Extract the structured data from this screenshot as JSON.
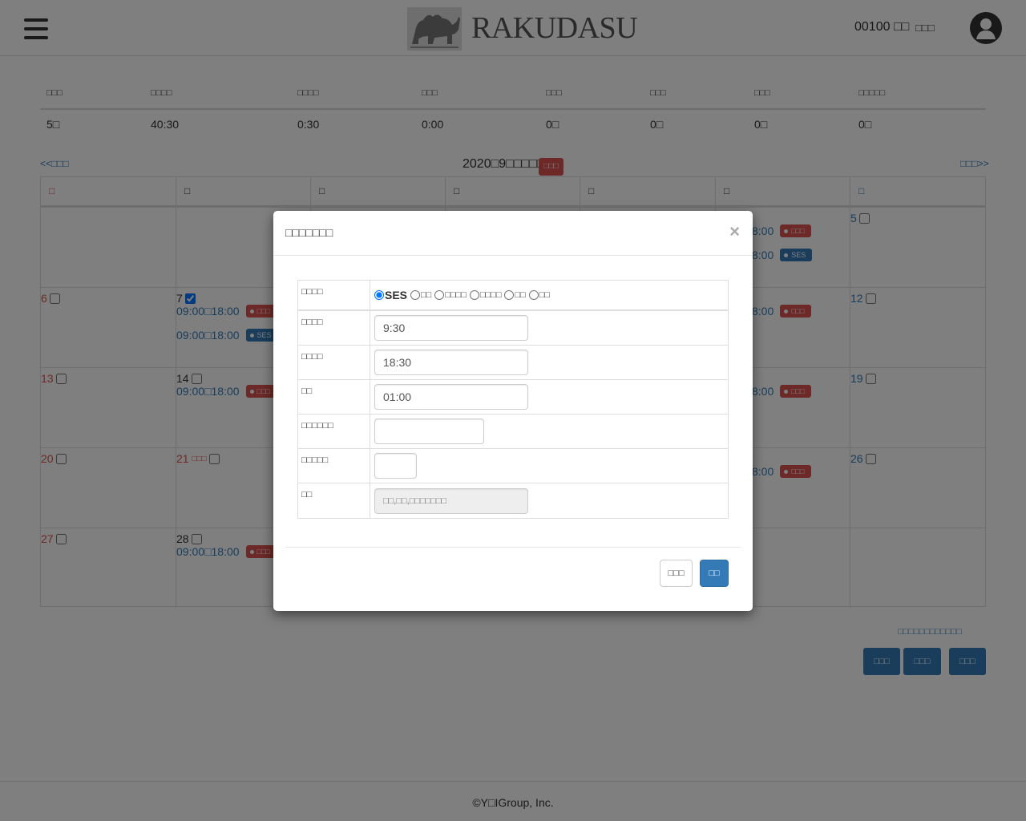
{
  "header": {
    "logo_text": "RAKUDASU",
    "user_code": "00100 □□",
    "logout_label": "□□□"
  },
  "summary": {
    "headers": [
      "□□□",
      "□□□□",
      "□□□□",
      "□□□",
      "□□□",
      "□□□",
      "□□□",
      "□□□□□"
    ],
    "values": [
      "5□",
      "40:30",
      "0:30",
      "0:00",
      "0□",
      "0□",
      "0□",
      "0□"
    ]
  },
  "calendar": {
    "prev_label": "<<□□□",
    "next_label": "□□□>>",
    "month_title": "2020□9□□□□□",
    "month_badge": "□□□",
    "weekdays": [
      "□",
      "□",
      "□",
      "□",
      "□",
      "□",
      "□"
    ],
    "tag_work": "□□□",
    "tag_ses": "SES",
    "time_range": "09:00□18:00",
    "time_partial": "8:00",
    "holiday_label": "□□□",
    "days": {
      "d5": "5",
      "d6": "6",
      "d7": "7",
      "d12": "12",
      "d13": "13",
      "d14": "14",
      "d19": "19",
      "d20": "20",
      "d21": "21",
      "d26": "26",
      "d27": "27",
      "d28": "28"
    }
  },
  "bottom": {
    "link": "□□□□□□□□□□□□",
    "btn1": "□□□",
    "btn2": "□□□",
    "btn3": "□□□"
  },
  "footer": {
    "copyright": "©Y□IGroup, Inc."
  },
  "modal": {
    "title": "□□□□□□□",
    "close": "×",
    "labels": {
      "type": "□□□□",
      "start": "□□□□",
      "end": "□□□□",
      "break": "□□",
      "f5": "□□□□□□",
      "f6": "□□□□□",
      "note": "□□"
    },
    "radios": [
      "SES",
      "□□",
      "□□□□",
      "□□□□",
      "□□",
      "□□"
    ],
    "values": {
      "start": "9:30",
      "end": "18:30",
      "break": "01:00",
      "f5": "",
      "f6": ""
    },
    "note_placeholder": "□□,□□,□□□□□□□",
    "cancel_label": "□□□",
    "save_label": "□□"
  }
}
